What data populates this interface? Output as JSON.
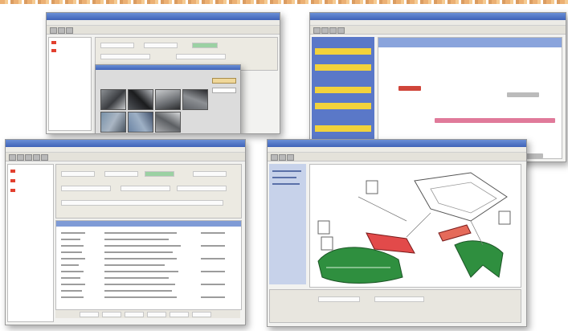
{
  "windows": {
    "photo_viewer": {
      "title": "",
      "thumbnail_count": 8
    },
    "schedule": {
      "title": "",
      "rows": 10
    },
    "parts_list": {
      "title": "",
      "rows": 12
    },
    "exploded_diagram": {
      "title": ""
    }
  },
  "colors": {
    "title_bar": "#4a6fc4",
    "schedule_highlight": "#f2d23c",
    "schedule_sidebar": "#5a78c8",
    "bar_red": "#d0453a",
    "bar_pink": "#e07a9a",
    "bar_green": "#3f9a4a",
    "diagram_green": "#2f8f3f",
    "diagram_red": "#e24a4a"
  },
  "icons": [
    "folder-icon",
    "photo-thumbnail-icon",
    "car-part-icon"
  ]
}
